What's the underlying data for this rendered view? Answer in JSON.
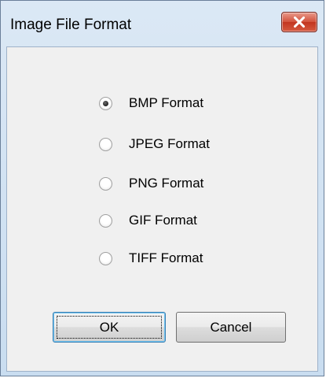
{
  "window": {
    "title": "Image File Format"
  },
  "titlebar": {
    "close_icon": "close-x-icon"
  },
  "format_options": [
    {
      "label": "BMP Format",
      "checked": true
    },
    {
      "label": "JPEG Format",
      "checked": false
    },
    {
      "label": "PNG Format",
      "checked": false
    },
    {
      "label": "GIF Format",
      "checked": false
    },
    {
      "label": "TIFF Format",
      "checked": false
    }
  ],
  "buttons": {
    "ok_label": "OK",
    "cancel_label": "Cancel"
  },
  "colors": {
    "close_button": "#c23520",
    "dialog_background": "#f0f0f0",
    "frame": "#c9ddf0"
  }
}
